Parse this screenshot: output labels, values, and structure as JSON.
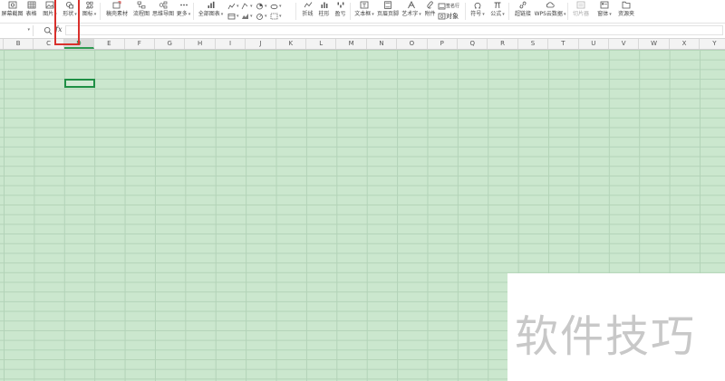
{
  "ribbon": {
    "screenshot": "屏幕截图",
    "table": "表格",
    "picture": "图片",
    "shape": "形状",
    "icon": "图标",
    "draft_material": "稿壳素材",
    "flowchart": "流程图",
    "mindmap": "思维导图",
    "more": "更多",
    "all_charts": "全部图表",
    "line": "折线",
    "column": "柱形",
    "win_loss": "盈亏",
    "text_box": "文本框",
    "header_footer": "页眉页脚",
    "word_art": "艺术字",
    "attachment": "附件",
    "signature_line": "签名行",
    "object": "对象",
    "symbol": "符号",
    "formula": "公式",
    "hyperlink": "超链接",
    "wps_cloud_data": "WPS云数据",
    "slicer": "切片器",
    "form": "窗体",
    "resource_center": "资源夹"
  },
  "formula_bar": {
    "fx": "fx",
    "cell_ref": "",
    "formula_value": ""
  },
  "columns": [
    "B",
    "C",
    "D",
    "E",
    "F",
    "G",
    "H",
    "I",
    "J",
    "K",
    "L",
    "M",
    "N",
    "O",
    "P",
    "Q",
    "R",
    "S",
    "T",
    "U",
    "V",
    "W",
    "X",
    "Y"
  ],
  "selected_column": "D",
  "watermark": "软件技巧",
  "colors": {
    "sheet_background": "#cbe7ce",
    "grid_lines": "#b3d3b8",
    "selection_border": "#1f8f45",
    "highlight_box": "#d9302c"
  }
}
